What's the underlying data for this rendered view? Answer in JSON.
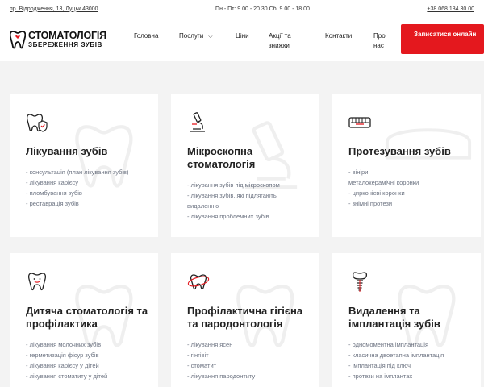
{
  "topbar": {
    "address": "пр. Відродження, 13, Луцьк 43000",
    "hours": "Пн - Пт: 9.00 - 20.30 Сб: 9.00 - 18.00",
    "phone": "+38 068 184 30 00"
  },
  "logo": {
    "line1": "СТОМАТОЛОГІЯ",
    "line2": "ЗБЕРЕЖЕННЯ ЗУБІВ",
    "accent": "#e4181e"
  },
  "nav": {
    "items": [
      {
        "label": "Головна"
      },
      {
        "label": "Послуги"
      },
      {
        "label": "Ціни"
      },
      {
        "label": "Акції та знижки"
      },
      {
        "label": "Контакти"
      },
      {
        "label": "Про нас"
      }
    ],
    "cta": "Записатися онлайн"
  },
  "cards": [
    {
      "title": "Лікування зубів",
      "icon": "tooth-shield-icon",
      "items": [
        "- консультація (план лікування зубів)",
        "- лікування карієсу",
        "- пломбування зубів",
        "- реставрація зубів"
      ]
    },
    {
      "title": "Мікроскопна стоматологія",
      "icon": "microscope-icon",
      "items": [
        "- лікування зубів під мікроскопом",
        "- лікування зубів, які підлягають видаленню",
        "- лікування проблемних зубів"
      ]
    },
    {
      "title": "Протезування зубів",
      "icon": "denture-icon",
      "items": [
        "- вініри",
        "металокерамічні коронки",
        "- цирконієві коронки",
        "- знімні протези"
      ]
    },
    {
      "title": "Дитяча стоматологія та профілактика",
      "icon": "smiling-tooth-icon",
      "items": [
        "- лікування молочних зубів",
        "- герметизація фісур зубів",
        "- лікування карієсу у дітей",
        "- лікування стоматиту у дітей"
      ]
    },
    {
      "title": "Профілактична гігієна та пародонтологія",
      "icon": "tooth-orbit-icon",
      "items": [
        "- лікування ясен",
        "- гінгівіт",
        "- стоматит",
        "- лікування пародонтиту"
      ]
    },
    {
      "title": "Видалення та імплантація зубів",
      "icon": "implant-icon",
      "items": [
        "- одномоментна імплантація",
        "- класична двоетапна імплантація",
        "- імплантація під ключ",
        "- протези на імплантах"
      ]
    }
  ]
}
